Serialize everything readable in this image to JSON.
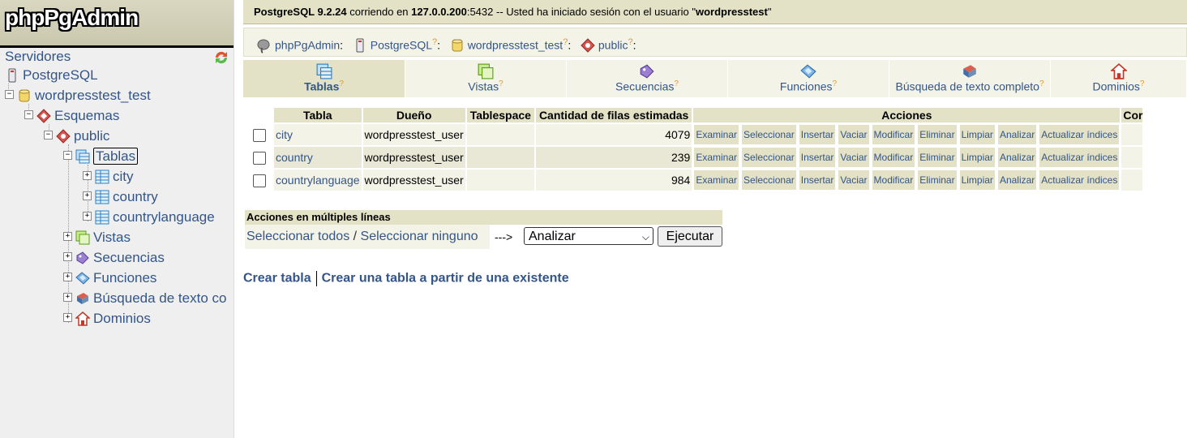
{
  "logo": "phpPgAdmin",
  "tree": {
    "servers": "Servidores",
    "server": "PostgreSQL",
    "database": "wordpresstest_test",
    "schemas": "Esquemas",
    "schema": "public",
    "tables": "Tablas",
    "table_items": [
      "city",
      "country",
      "countrylanguage"
    ],
    "views": "Vistas",
    "sequences": "Secuencias",
    "functions": "Funciones",
    "fulltext": "Búsqueda de texto co",
    "domains": "Dominios"
  },
  "topbar": {
    "product": "PostgreSQL 9.2.24",
    "running_on": " corriendo en ",
    "host": "127.0.0.200",
    "port_text": ":5432 -- Usted ha iniciado sesión con el usuario \"",
    "user": "wordpresstest",
    "end_quote": "\""
  },
  "trail": {
    "app": "phpPgAdmin",
    "server": "PostgreSQL",
    "database": "wordpresstest_test",
    "schema": "public",
    "help": "?",
    "colon": ":"
  },
  "tabs": [
    {
      "label": "Tablas",
      "icon": "tables-icon",
      "width": 200
    },
    {
      "label": "Vistas",
      "icon": "views-icon",
      "width": 199
    },
    {
      "label": "Secuencias",
      "icon": "sequences-icon",
      "width": 199
    },
    {
      "label": "Funciones",
      "icon": "functions-icon",
      "width": 199
    },
    {
      "label": "Búsqueda de texto completo",
      "icon": "fulltext-icon",
      "width": 199
    },
    {
      "label": "Dominios",
      "icon": "domains-icon",
      "width": 168
    }
  ],
  "table": {
    "headers": [
      "Tabla",
      "Dueño",
      "Tablespace",
      "Cantidad de filas estimadas",
      "Acciones",
      "Cor"
    ],
    "actions": [
      "Examinar",
      "Seleccionar",
      "Insertar",
      "Vaciar",
      "Modificar",
      "Eliminar",
      "Limpiar",
      "Analizar",
      "Actualizar índices"
    ],
    "rows": [
      {
        "name": "city",
        "owner": "wordpresstest_user",
        "tablespace": "",
        "rows": "4079"
      },
      {
        "name": "country",
        "owner": "wordpresstest_user",
        "tablespace": "",
        "rows": "239"
      },
      {
        "name": "countrylanguage",
        "owner": "wordpresstest_user",
        "tablespace": "",
        "rows": "984"
      }
    ]
  },
  "multi": {
    "title": "Acciones en múltiples líneas",
    "select_all": "Seleccionar todos",
    "slash": " / ",
    "select_none": "Seleccionar ninguno",
    "arrow": "--->",
    "selected_action": "Analizar",
    "execute": "Ejecutar"
  },
  "bottom": {
    "create_table": "Crear tabla",
    "create_like": "Crear una tabla a partir de una existente"
  },
  "colors": {
    "accent": "#e3e1c6",
    "link": "#335588",
    "help": "#e59a2c"
  }
}
